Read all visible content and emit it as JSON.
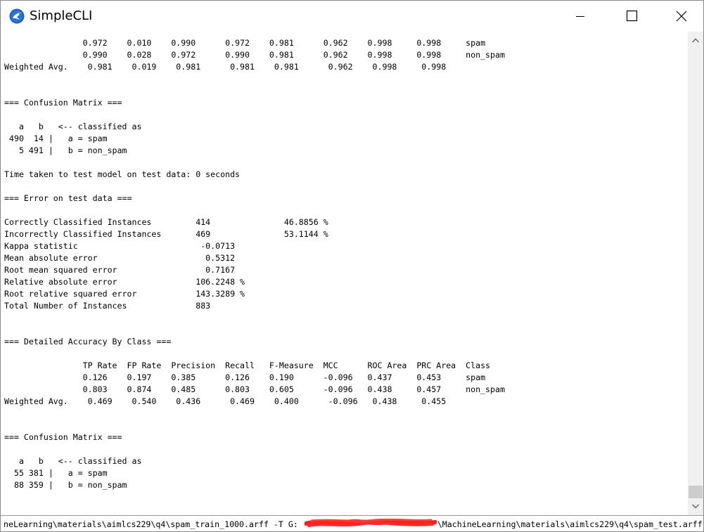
{
  "window": {
    "title": "SimpleCLI",
    "logo_icon": "weka-bird-icon",
    "controls": [
      "minimize-icon",
      "maximize-icon",
      "close-icon"
    ]
  },
  "output": {
    "lines": [
      "                0.972    0.010    0.990      0.972    0.981      0.962    0.998     0.998     spam",
      "                0.990    0.028    0.972      0.990    0.981      0.962    0.998     0.998     non_spam",
      "Weighted Avg.    0.981    0.019    0.981      0.981    0.981      0.962    0.998     0.998",
      "",
      "",
      "=== Confusion Matrix ===",
      "",
      "   a   b   <-- classified as",
      " 490  14 |   a = spam",
      "   5 491 |   b = non_spam",
      "",
      "Time taken to test model on test data: 0 seconds",
      "",
      "=== Error on test data ===",
      "",
      "Correctly Classified Instances         414               46.8856 %",
      "Incorrectly Classified Instances       469               53.1144 %",
      "Kappa statistic                         -0.0713",
      "Mean absolute error                      0.5312",
      "Root mean squared error                  0.7167",
      "Relative absolute error                106.2248 %",
      "Root relative squared error            143.3289 %",
      "Total Number of Instances              883",
      "",
      "",
      "=== Detailed Accuracy By Class ===",
      "",
      "                TP Rate  FP Rate  Precision  Recall   F-Measure  MCC      ROC Area  PRC Area  Class",
      "                0.126    0.197    0.385      0.126    0.190      -0.096   0.437     0.453     spam",
      "                0.803    0.874    0.485      0.803    0.605      -0.096   0.438     0.457     non_spam",
      "Weighted Avg.    0.469    0.540    0.436      0.469    0.400      -0.096   0.438     0.455",
      "",
      "",
      "=== Confusion Matrix ===",
      "",
      "   a   b   <-- classified as",
      "  55 381 |   a = spam",
      "  88 359 |   b = non_spam"
    ]
  },
  "scrollbar": {
    "up_icon": "scroll-up-arrow-icon",
    "down_icon": "scroll-down-arrow-icon",
    "position": 0.98
  },
  "command": {
    "prefix": "neLearning\\materials\\aimlcs229\\q4\\spam_train_1000.arff -T G:",
    "suffix": "\\MachineLearning\\materials\\aimlcs229\\q4\\spam_test.arff",
    "redacted": true
  }
}
